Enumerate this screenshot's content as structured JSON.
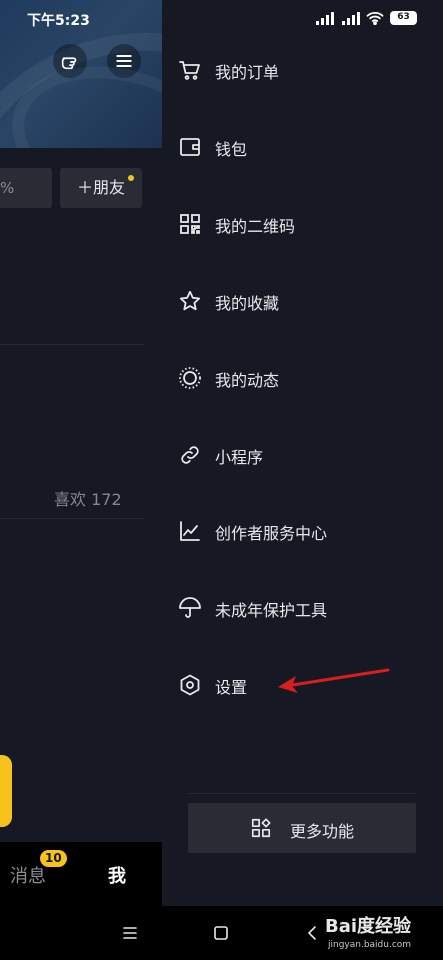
{
  "status_bar": {
    "time": "下午5:23",
    "battery": "63"
  },
  "profile": {
    "percent_partial": "%",
    "add_friend_label": "＋朋友",
    "likes_text": "喜欢 172"
  },
  "bottom_nav": {
    "messages_label": "消息",
    "messages_badge": "10",
    "me_label": "我"
  },
  "drawer": {
    "items": [
      {
        "label": "我的订单",
        "icon": "cart-icon"
      },
      {
        "label": "钱包",
        "icon": "wallet-icon"
      },
      {
        "label": "我的二维码",
        "icon": "qrcode-icon"
      },
      {
        "label": "我的收藏",
        "icon": "star-icon"
      },
      {
        "label": "我的动态",
        "icon": "dotted-circle-icon"
      },
      {
        "label": "小程序",
        "icon": "link-icon"
      },
      {
        "label": "创作者服务中心",
        "icon": "chart-line-icon"
      },
      {
        "label": "未成年保护工具",
        "icon": "umbrella-icon"
      },
      {
        "label": "设置",
        "icon": "settings-hexagon-icon"
      }
    ],
    "more_label": "更多功能"
  },
  "annotation": {
    "arrow_color": "#d81e1e"
  },
  "watermark": {
    "main": "Bai度经验",
    "sub": "jingyan.baidu.com"
  },
  "colors": {
    "background": "#161823",
    "accent": "#f8c21c",
    "button_bg": "#2a2c35"
  }
}
